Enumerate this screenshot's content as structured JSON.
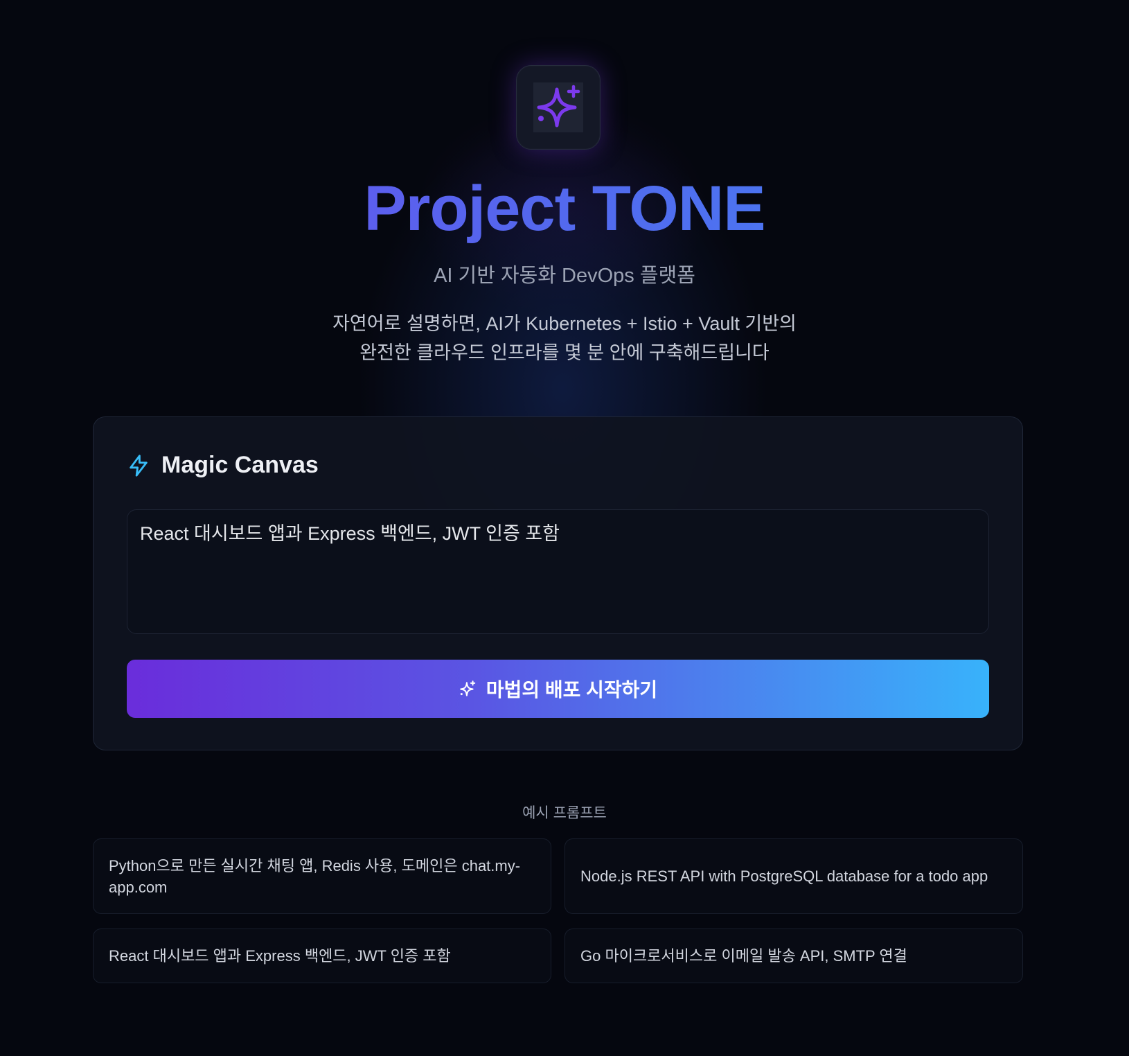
{
  "colors": {
    "background": "#05070f",
    "title_gradient_start": "#6d4cf0",
    "title_gradient_end": "#3f86f3",
    "logo_star": "#7c3aed",
    "accent_bolt": "#38bdf8",
    "button_gradient_start": "#6a2ddb",
    "button_gradient_end": "#38b2fb"
  },
  "hero": {
    "logo_icon": "sparkles-icon",
    "title": "Project TONE",
    "subtitle": "AI 기반 자동화 DevOps 플랫폼",
    "description_line1": "자연어로 설명하면, AI가 Kubernetes + Istio + Vault 기반의",
    "description_line2": "완전한 클라우드 인프라를 몇 분 안에 구축해드립니다"
  },
  "canvas": {
    "icon": "lightning-icon",
    "title": "Magic Canvas",
    "prompt_value": "React 대시보드 앱과 Express 백엔드, JWT 인증 포함",
    "button_icon": "sparkles-icon",
    "button_label": "마법의 배포 시작하기"
  },
  "examples": {
    "heading": "예시 프롬프트",
    "items": [
      "Python으로 만든 실시간 채팅 앱, Redis 사용, 도메인은 chat.my-app.com",
      "Node.js REST API with PostgreSQL database for a todo app",
      "React 대시보드 앱과 Express 백엔드, JWT 인증 포함",
      "Go 마이크로서비스로 이메일 발송 API, SMTP 연결"
    ]
  }
}
